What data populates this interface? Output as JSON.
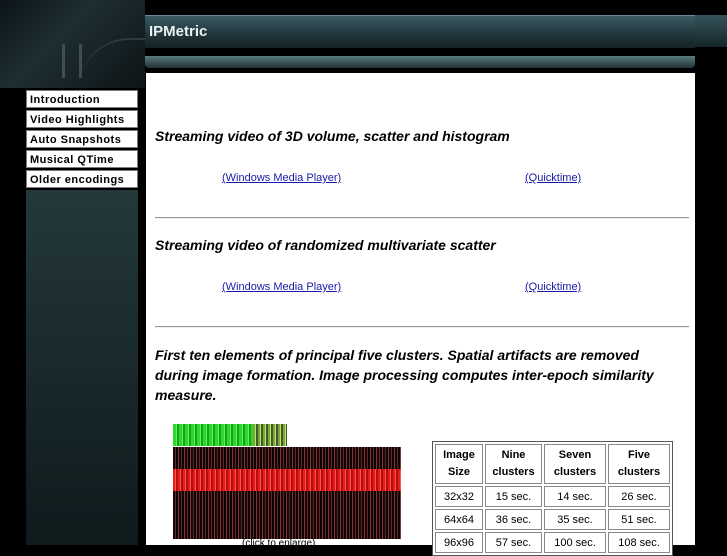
{
  "header": {
    "site_title": "IPMetric"
  },
  "nav": {
    "items": [
      {
        "label": "Introduction"
      },
      {
        "label": "Video Highlights"
      },
      {
        "label": "Auto Snapshots"
      },
      {
        "label": "Musical QTime"
      },
      {
        "label": "Older encodings"
      }
    ]
  },
  "sections": [
    {
      "title": "Streaming video of 3D volume, scatter and histogram",
      "link_wmp": "(Windows Media Player)",
      "link_qt": "(Quicktime)"
    },
    {
      "title": "Streaming video of randomized multivariate scatter",
      "link_wmp": "(Windows Media Player)",
      "link_qt": "(Quicktime)"
    }
  ],
  "clusters": {
    "description": "First ten elements of principal five clusters. Spatial artifacts are removed during image formation. Image processing computes inter-epoch similarity measure.",
    "image_caption": "(click to enlarge)",
    "table": {
      "headers": [
        [
          "Image",
          "Size"
        ],
        [
          "Nine",
          "clusters"
        ],
        [
          "Seven",
          "clusters"
        ],
        [
          "Five",
          "clusters"
        ]
      ],
      "rows": [
        [
          "32x32",
          "15 sec.",
          "14 sec.",
          "26 sec."
        ],
        [
          "64x64",
          "36 sec.",
          "35 sec.",
          "51 sec."
        ],
        [
          "96x96",
          "57 sec.",
          "100 sec.",
          "108 sec."
        ]
      ]
    }
  },
  "colors": {
    "background": "#000000",
    "content": "#ffffff",
    "link": "#1a1aa6",
    "header_bar": "#1f3439"
  }
}
